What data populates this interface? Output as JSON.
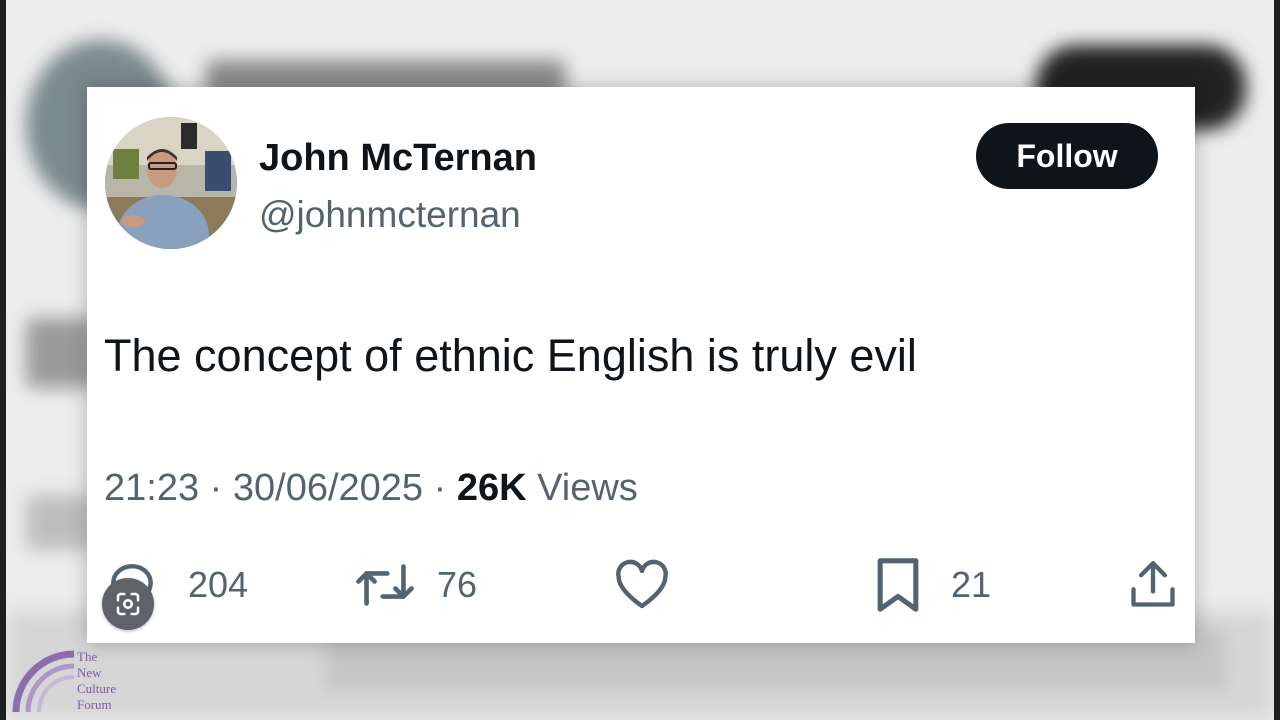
{
  "tweet": {
    "author_name": "John McTernan",
    "author_handle": "@johnmcternan",
    "follow_label": "Follow",
    "text": "The concept of ethnic English is truly evil",
    "time": "21:23",
    "date": "30/06/2025",
    "views_count": "26K",
    "views_label": "Views",
    "separator": "·",
    "replies": "204",
    "retweets": "76",
    "bookmarks": "21"
  },
  "watermark": {
    "line1": "The",
    "line2": "New",
    "line3": "Culture",
    "line4": "Forum"
  },
  "colors": {
    "follow_bg": "#0f1419",
    "secondary_text": "#536471",
    "watermark": "#7e5aa3"
  },
  "icons": {
    "reply": "reply-icon",
    "retweet": "retweet-icon",
    "like": "heart-icon",
    "bookmark": "bookmark-icon",
    "share": "share-icon",
    "lens": "lens-icon"
  }
}
